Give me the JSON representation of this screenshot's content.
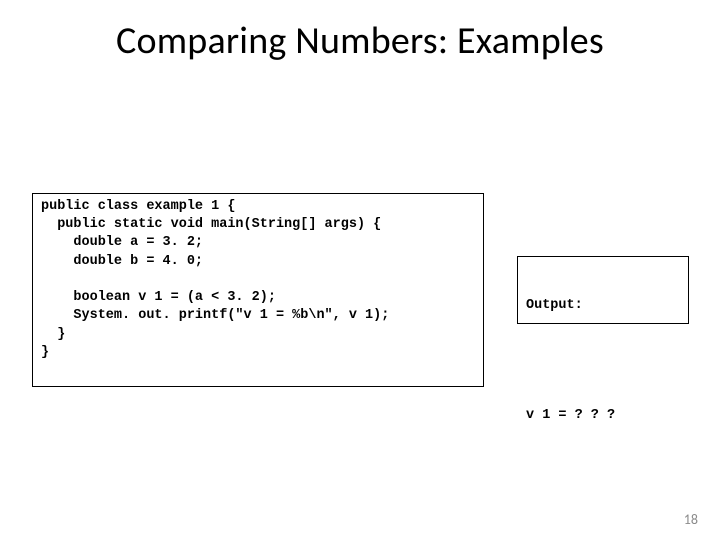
{
  "title": "Comparing Numbers: Examples",
  "code": "public class example 1 {\n  public static void main(String[] args) {\n    double a = 3. 2;\n    double b = 4. 0;\n\n    boolean v 1 = (a < 3. 2);\n    System. out. printf(\"v 1 = %b\\n\", v 1);\n  }\n}",
  "output": {
    "label": "Output:",
    "value": "v 1 = ? ? ?"
  },
  "page_number": "18"
}
